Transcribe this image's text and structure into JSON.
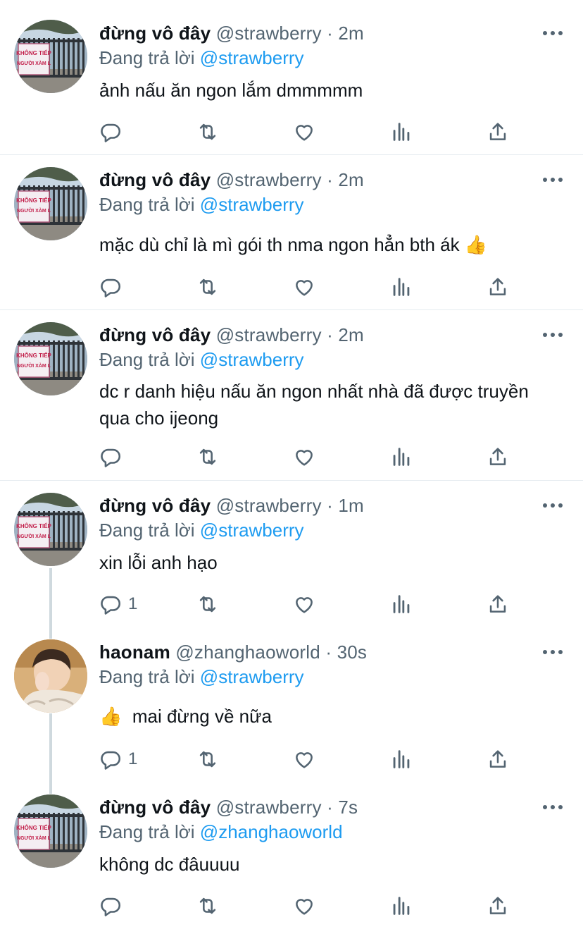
{
  "tweets": [
    {
      "name": "đừng vô đây",
      "handle": "@strawberry",
      "time": "2m",
      "reply_prefix": "Đang trả lời",
      "reply_to": "@strawberry",
      "text": "ảnh nấu ăn ngon lắm dmmmmm",
      "reply_count": "",
      "avatar": "gate-sign-avatar"
    },
    {
      "name": "đừng vô đây",
      "handle": "@strawberry",
      "time": "2m",
      "reply_prefix": "Đang trả lời",
      "reply_to": "@strawberry",
      "text": "mặc dù chỉ là mì gói th nma ngon hẳn bth ák 👍",
      "reply_count": "",
      "avatar": "gate-sign-avatar"
    },
    {
      "name": "đừng vô đây",
      "handle": "@strawberry",
      "time": "2m",
      "reply_prefix": "Đang trả lời",
      "reply_to": "@strawberry",
      "text": "dc r danh hiệu nấu ăn ngon nhất nhà đã được truyền qua cho ijeong",
      "reply_count": "",
      "avatar": "gate-sign-avatar"
    },
    {
      "name": "đừng vô đây",
      "handle": "@strawberry",
      "time": "1m",
      "reply_prefix": "Đang trả lời",
      "reply_to": "@strawberry",
      "text": "xin lỗi anh hạo",
      "reply_count": "1",
      "avatar": "gate-sign-avatar"
    },
    {
      "name": "haonam",
      "handle": "@zhanghaoworld",
      "time": "30s",
      "reply_prefix": "Đang trả lời",
      "reply_to": "@strawberry",
      "text": "👍  mai đừng về nữa",
      "reply_count": "1",
      "avatar": "person-avatar"
    },
    {
      "name": "đừng vô đây",
      "handle": "@strawberry",
      "time": "7s",
      "reply_prefix": "Đang trả lời",
      "reply_to": "@zhanghaoworld",
      "text": "không dc đâuuuu",
      "reply_count": "",
      "avatar": "gate-sign-avatar"
    }
  ],
  "sign_text_line1": "KHÔNG TIẾP",
  "sign_text_line2": "NGƯỜI XÀM L",
  "colors": {
    "link": "#1d9bf0",
    "secondary": "#536471",
    "divider": "#e6ecf0",
    "thread_line": "#cfd9de"
  },
  "icons": [
    "reply-icon",
    "retweet-icon",
    "like-icon",
    "analytics-icon",
    "share-icon",
    "more-icon"
  ]
}
